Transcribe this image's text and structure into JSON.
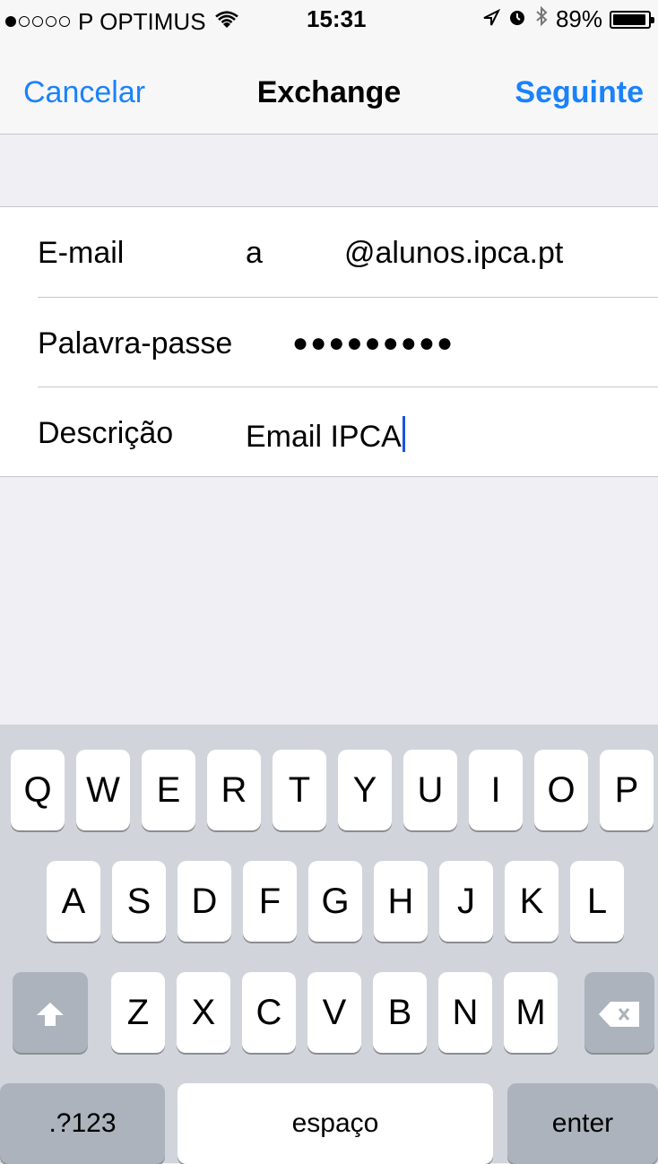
{
  "status_bar": {
    "carrier": "P OPTIMUS",
    "time": "15:31",
    "battery": "89%",
    "battery_level": 0.89
  },
  "nav": {
    "cancel": "Cancelar",
    "title": "Exchange",
    "next": "Seguinte"
  },
  "form": {
    "email_label": "E-mail",
    "email_user": "a",
    "email_domain": "@alunos.ipca.pt",
    "password_label": "Palavra-passe",
    "password_value": "●●●●●●●●●",
    "description_label": "Descrição",
    "description_value": "Email IPCA"
  },
  "keyboard": {
    "row1": [
      "Q",
      "W",
      "E",
      "R",
      "T",
      "Y",
      "U",
      "I",
      "O",
      "P"
    ],
    "row2": [
      "A",
      "S",
      "D",
      "F",
      "G",
      "H",
      "J",
      "K",
      "L"
    ],
    "row3": [
      "Z",
      "X",
      "C",
      "V",
      "B",
      "N",
      "M"
    ],
    "numbers": ".?123",
    "space": "espaço",
    "enter": "enter"
  },
  "colors": {
    "accent": "#1a82fb",
    "caret": "#1a52e6",
    "keyboard_bg": "#d1d5db"
  }
}
